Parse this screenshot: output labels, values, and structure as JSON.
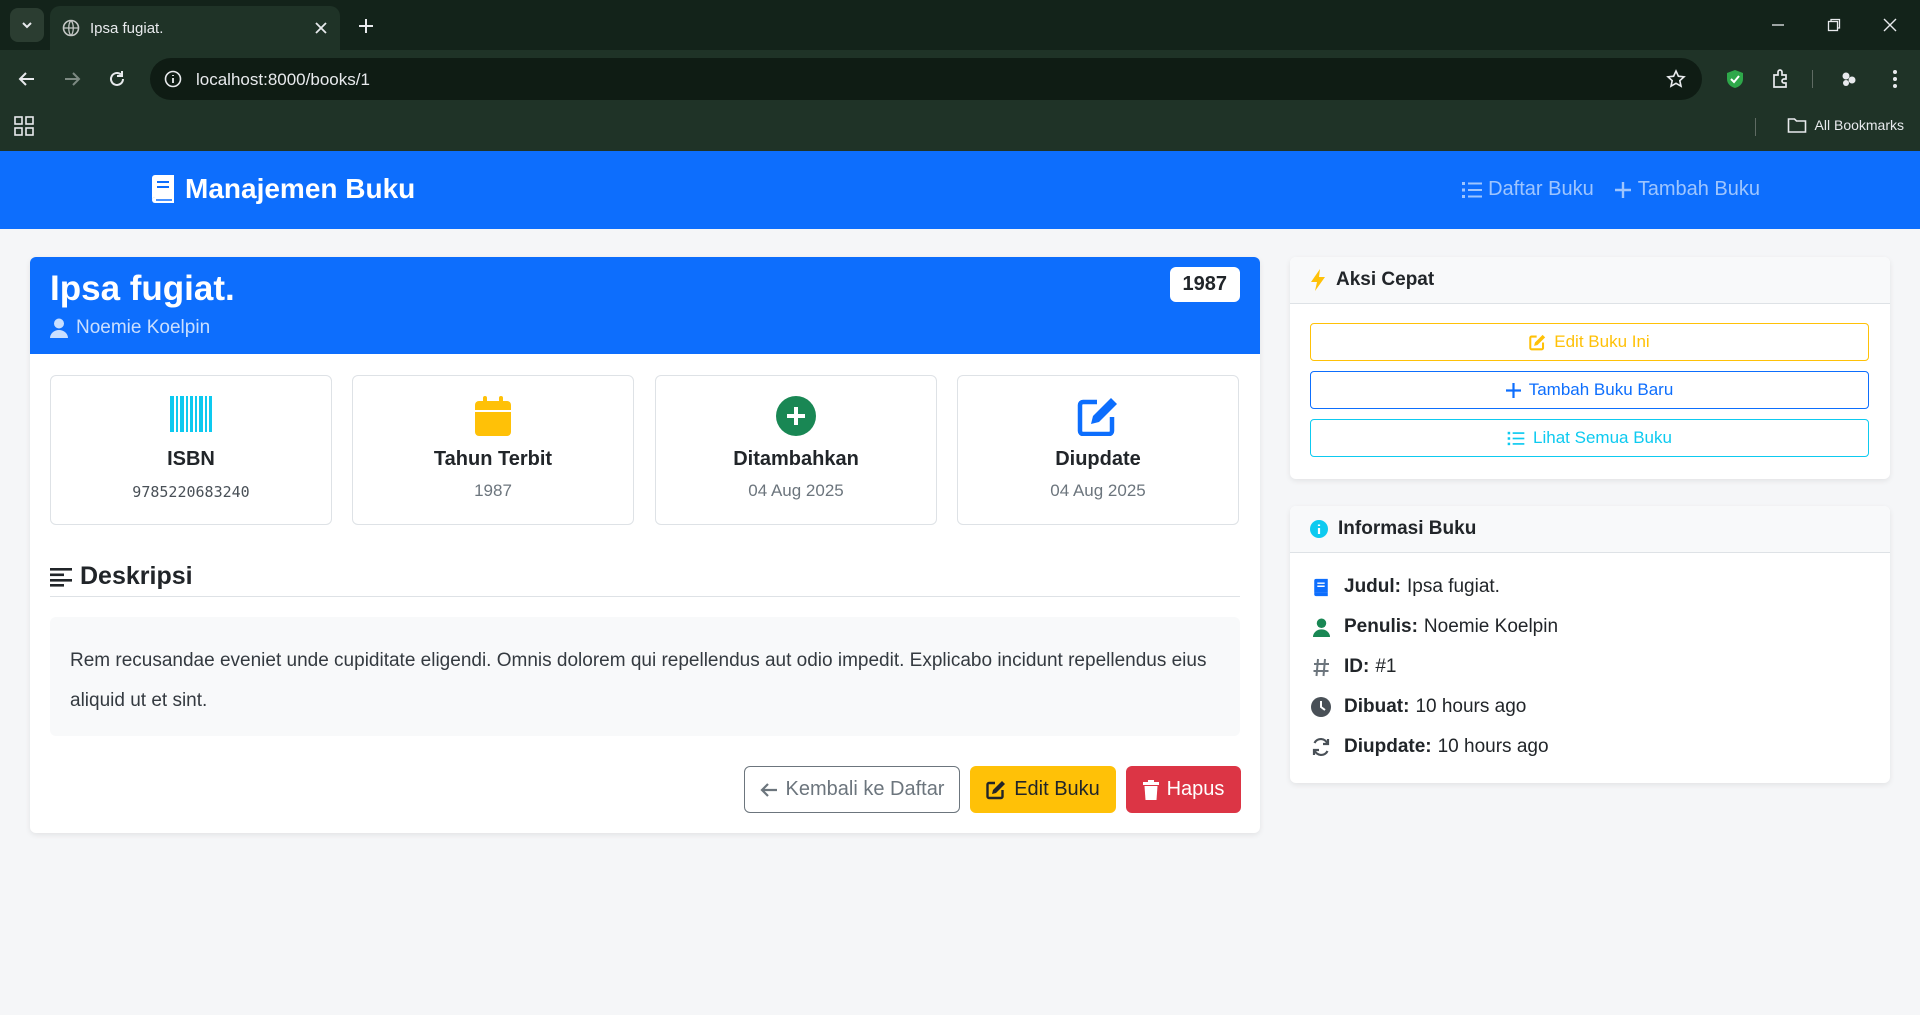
{
  "browser": {
    "tab_title": "Ipsa fugiat.",
    "url": "localhost:8000/books/1",
    "all_bookmarks": "All Bookmarks"
  },
  "navbar": {
    "brand": "Manajemen Buku",
    "links": [
      "Daftar Buku",
      "Tambah Buku"
    ]
  },
  "book": {
    "title": "Ipsa fugiat.",
    "author": "Noemie Koelpin",
    "year_badge": "1987",
    "stats": [
      {
        "label": "ISBN",
        "value": "9785220683240",
        "icon": "barcode-icon"
      },
      {
        "label": "Tahun Terbit",
        "value": "1987",
        "icon": "calendar-icon"
      },
      {
        "label": "Ditambahkan",
        "value": "04 Aug 2025",
        "icon": "plus-circle-icon"
      },
      {
        "label": "Diupdate",
        "value": "04 Aug 2025",
        "icon": "edit-icon"
      }
    ],
    "description_heading": "Deskripsi",
    "description": "Rem recusandae eveniet unde cupiditate eligendi. Omnis dolorem qui repellendus aut odio impedit. Explicabo incidunt repellendus eius aliquid ut et sint.",
    "buttons": {
      "back": "Kembali ke Daftar",
      "edit": "Edit Buku",
      "delete": "Hapus"
    }
  },
  "quick_actions": {
    "heading": "Aksi Cepat",
    "edit": "Edit Buku Ini",
    "add": "Tambah Buku Baru",
    "list": "Lihat Semua Buku"
  },
  "info": {
    "heading": "Informasi Buku",
    "rows": [
      {
        "label": "Judul:",
        "value": "Ipsa fugiat."
      },
      {
        "label": "Penulis:",
        "value": "Noemie Koelpin"
      },
      {
        "label": "ID:",
        "value": "#1"
      },
      {
        "label": "Dibuat:",
        "value": "10 hours ago"
      },
      {
        "label": "Diupdate:",
        "value": "10 hours ago"
      }
    ]
  },
  "colors": {
    "primary": "#0d6efd",
    "warning": "#ffc107",
    "danger": "#dc3545",
    "info": "#0dcaf0",
    "success": "#198754"
  }
}
